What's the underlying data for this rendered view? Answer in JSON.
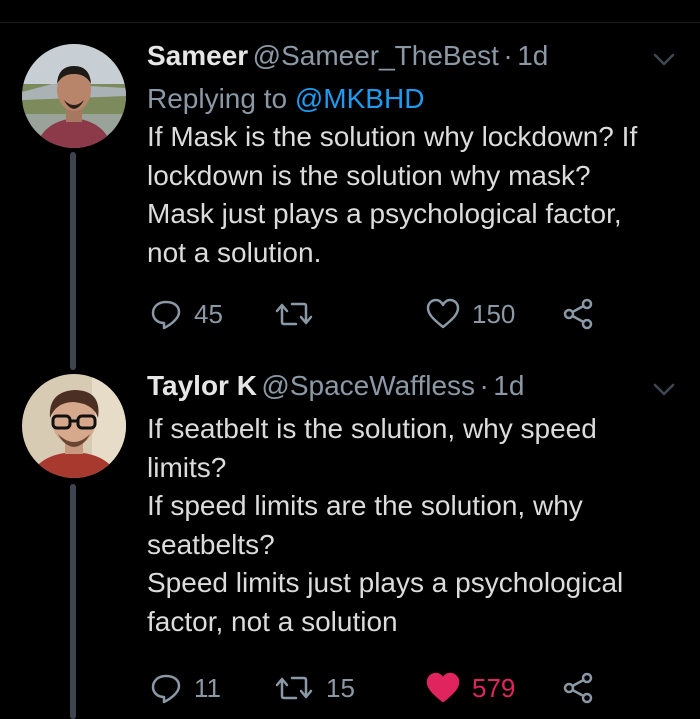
{
  "tweets": [
    {
      "name": "Sameer",
      "handle": "@Sameer_TheBest",
      "separator": "·",
      "time": "1d",
      "replying_prefix": "Replying to",
      "replying_to": "@MKBHD",
      "text": "If Mask is the solution why lockdown? If\nlockdown is the solution why mask?\nMask just plays a psychological factor,\nnot a solution.",
      "replies": "45",
      "retweets": "",
      "likes": "150",
      "liked": false
    },
    {
      "name": "Taylor K",
      "handle": "@SpaceWaffless",
      "separator": "·",
      "time": "1d",
      "text": "If seatbelt is the solution, why speed\nlimits?\nIf speed limits are the solution, why\nseatbelts?\nSpeed limits just plays a psychological\nfactor, not a solution",
      "replies": "11",
      "retweets": "15",
      "likes": "579",
      "liked": true
    }
  ],
  "colors": {
    "background": "#000000",
    "text": "#dcdcdc",
    "muted": "#8b98a5",
    "link": "#1d9bf0",
    "like_active": "#e0245e",
    "thread_line": "#3d4650"
  },
  "icons": [
    "reply-icon",
    "retweet-icon",
    "like-icon",
    "share-icon",
    "chevron-down-icon"
  ]
}
